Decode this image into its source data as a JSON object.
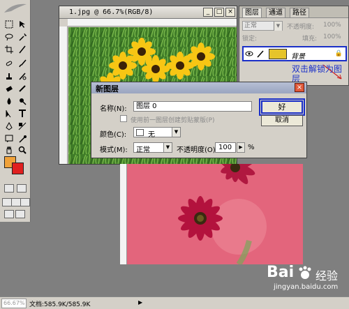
{
  "document1": {
    "title": "1.jpg @ 66.7%(RGB/8)",
    "buttons": [
      "_",
      "□",
      "×"
    ]
  },
  "layers_panel": {
    "tabs": [
      "图层",
      "通道",
      "路径"
    ],
    "blend_mode": "正常",
    "opacity_label": "不透明度:",
    "opacity_value": "100%",
    "lock_label": "锁定:",
    "fill_label": "填充:",
    "fill_value": "100%",
    "layer_name": "背景"
  },
  "annotation": "双击解锁为图层",
  "dialog": {
    "title": "新图层",
    "close": "×",
    "name_label": "名称(N):",
    "name_value": "图层 0",
    "checkbox_label": "使用前一图层创建剪贴蒙版(P)",
    "color_label": "颜色(C):",
    "color_value": "无",
    "mode_label": "模式(M):",
    "mode_value": "正常",
    "opacity_label": "不透明度(O):",
    "opacity_value": "100",
    "opacity_unit": "%",
    "ok": "好",
    "cancel": "取消"
  },
  "status_bar": {
    "zoom": "66.67%",
    "doc": "文档:585.9K/585.9K",
    "arrow": "▶"
  },
  "watermark": {
    "brand": "Bai",
    "cn": "经验",
    "url": "jingyan.baidu.com"
  },
  "colors": {
    "foreground": "#f0a23a",
    "background": "#e02020",
    "highlight": "#1a2fc8"
  }
}
